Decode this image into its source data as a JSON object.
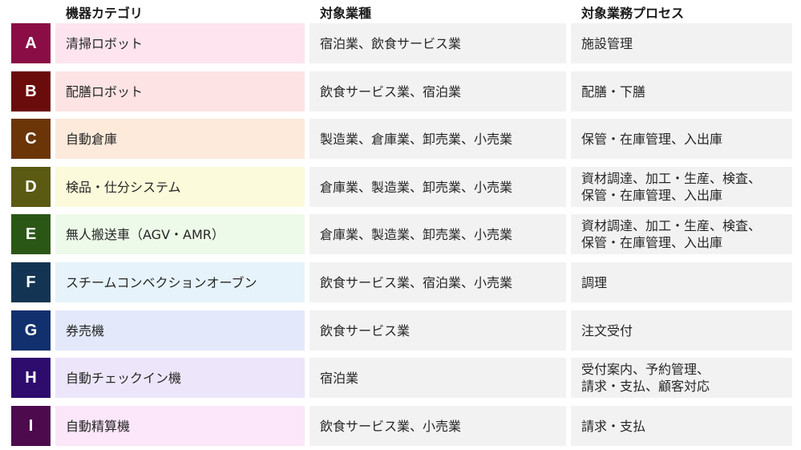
{
  "headers": {
    "category": "機器カテゴリ",
    "industry": "対象業種",
    "process": "対象業務プロセス"
  },
  "rows": [
    {
      "letter": "A",
      "category": "清掃ロボット",
      "industry": "宿泊業、飲食サービス業",
      "process": "施設管理",
      "letter_color": "#8b0d45",
      "category_color": "#fde4ef"
    },
    {
      "letter": "B",
      "category": "配膳ロボット",
      "industry": "飲食サービス業、宿泊業",
      "process": "配膳・下膳",
      "letter_color": "#6b0c0c",
      "category_color": "#fde3e3"
    },
    {
      "letter": "C",
      "category": "自動倉庫",
      "industry": "製造業、倉庫業、卸売業、小売業",
      "process": "保管・在庫管理、入出庫",
      "letter_color": "#6b3508",
      "category_color": "#fdeadb"
    },
    {
      "letter": "D",
      "category": "検品・仕分システム",
      "industry": "倉庫業、製造業、卸売業、小売業",
      "process": "資材調達、加工・生産、検査、\n保管・在庫管理、入出庫",
      "letter_color": "#5a5a12",
      "category_color": "#fbfadb"
    },
    {
      "letter": "E",
      "category": "無人搬送車（AGV・AMR）",
      "industry": "倉庫業、製造業、卸売業、小売業",
      "process": "資材調達、加工・生産、検査、\n保管・在庫管理、入出庫",
      "letter_color": "#2b5716",
      "category_color": "#eefae9"
    },
    {
      "letter": "F",
      "category": "スチームコンベクションオーブン",
      "industry": "飲食サービス業、宿泊業、小売業",
      "process": "調理",
      "letter_color": "#133553",
      "category_color": "#e6f3fb"
    },
    {
      "letter": "G",
      "category": "券売機",
      "industry": "飲食サービス業",
      "process": "注文受付",
      "letter_color": "#12306e",
      "category_color": "#e3e9fb"
    },
    {
      "letter": "H",
      "category": "自動チェックイン機",
      "industry": "宿泊業",
      "process": "受付案内、予約管理、\n請求・支払、顧客対応",
      "letter_color": "#2e0c6e",
      "category_color": "#ede6fb"
    },
    {
      "letter": "I",
      "category": "自動精算機",
      "industry": "飲食サービス業、小売業",
      "process": "請求・支払",
      "letter_color": "#4d0a4d",
      "category_color": "#fbe6fa"
    }
  ]
}
